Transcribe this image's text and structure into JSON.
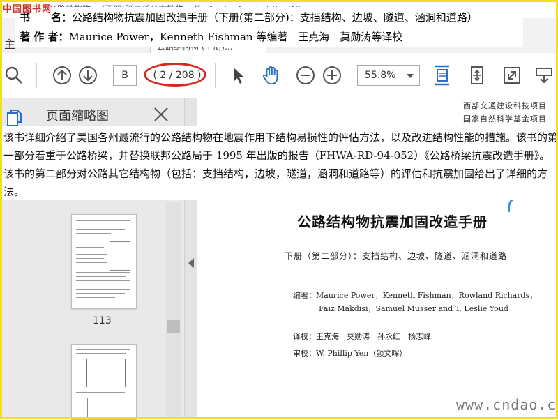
{
  "window": {
    "logo_text": "中国图书网",
    "title": "公路结构物… (下册)第二部分支挡物.pdf - Adobe Acrobat Pro DC"
  },
  "tabs": {
    "home_label": "主",
    "doc_label": "公路结构物 (下册)..."
  },
  "book_info": {
    "title_key": "书　　名：",
    "title_value": "公路结构物抗震加固改造手册（下册(第二部分)：支挡结构、边坡、隧道、涵洞和道路）",
    "author_key": "著 作 者：",
    "author_value": "Maurice Power，Kenneth Fishman 等编著　王克海　莫勋涛等译校"
  },
  "toolbar": {
    "current_page": "B",
    "page_count": "( 2 / 208 )",
    "zoom": "55.8%",
    "icons": [
      "search-icon",
      "page-up-icon",
      "page-down-icon",
      "select-cursor-icon",
      "hand-tool-icon",
      "zoom-out-icon",
      "zoom-in-icon",
      "fit-page-icon",
      "fit-width-icon",
      "full-screen-icon",
      "scroll-mode-icon"
    ]
  },
  "left_panel": {
    "title": "页面缩略图",
    "thumb_label": "113"
  },
  "description": "该书详细介绍了美国各州最流行的公路结构物在地震作用下结构易损性的评估方法，以及改进结构性能的措施。该书的第一部分着重于公路桥梁，并替换联邦公路局于 1995 年出版的报告（FHWA-RD-94-052）《公路桥梁抗震改造手册》。该书的第二部分对公路其它结构物（包括：支挡结构，边坡，隧道，涵洞和道路等）的评估和抗震加固给出了详细的方法。",
  "document": {
    "header_line1": "西部交通建设科技项目",
    "header_line2": "国家自然科学基金项目",
    "title": "公路结构物抗震加固改造手册",
    "subtitle": "下册（第二部分）：支挡结构、边坡、隧道、涵洞和道路",
    "editors_line1": "编著：Maurice Power，Kenneth Fishman，Rowland Richards，",
    "editors_line2": "Faiz Makdisi，Samuel Musser and T. Leslie Youd",
    "translators": "译校：王克海　莫勋涛　孙永红　杨志峰",
    "reviewer": "审校：W. Phillip Yen（颜文晖）",
    "watermark": "www.cndao.com"
  },
  "colors": {
    "accent_blue": "#2a6fc9",
    "highlight_red": "#d42a1f",
    "frame_yellow": "#f0e020"
  }
}
